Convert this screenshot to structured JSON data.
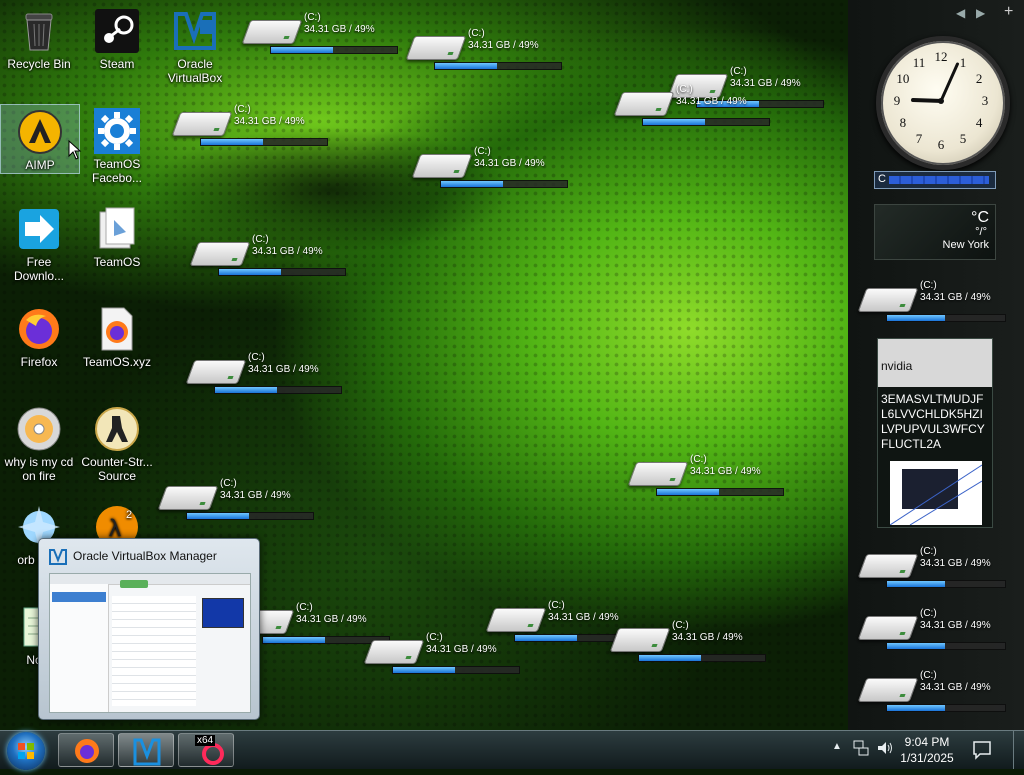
{
  "desktop_icons": [
    {
      "id": "recycle",
      "label": "Recycle Bin"
    },
    {
      "id": "steam",
      "label": "Steam"
    },
    {
      "id": "vbox",
      "label": "Oracle VirtualBox"
    },
    {
      "id": "aimp",
      "label": "AIMP"
    },
    {
      "id": "teamos-fb",
      "label": "TeamOS Facebo..."
    },
    {
      "id": "fdm",
      "label": "Free Downlo..."
    },
    {
      "id": "teamos",
      "label": "TeamOS"
    },
    {
      "id": "firefox",
      "label": "Firefox"
    },
    {
      "id": "teamosxyz",
      "label": "TeamOS.xyz"
    },
    {
      "id": "cd",
      "label": "why is my cd on fire"
    },
    {
      "id": "cs",
      "label": "Counter-Str... Source"
    },
    {
      "id": "orb",
      "label": "orb cum"
    },
    {
      "id": "hl2",
      "label": ""
    },
    {
      "id": "notepad",
      "label": "Note"
    }
  ],
  "drive_meter": {
    "drive": "(C:)",
    "usage": "34.31 GB / 49%",
    "percent_used": 49
  },
  "sidebar": {
    "nav_prev": "◀",
    "nav_next": "▶",
    "add": "+",
    "cpu_label": "C",
    "weather_unit": "°C",
    "weather_temp": "°/°",
    "weather_city": "New York",
    "notes_title": "nvidia",
    "notes_text": "3EMASVLTMUDJFL6LVVCHLDK5HZILVPUPVUL3WFCYFLUCTL2A",
    "clock": {
      "hour": 9,
      "minute": 4
    }
  },
  "preview": {
    "title": "Oracle VirtualBox Manager"
  },
  "taskbar": {
    "time": "9:04 PM",
    "date": "1/31/2025",
    "tag_x64": "x64"
  }
}
